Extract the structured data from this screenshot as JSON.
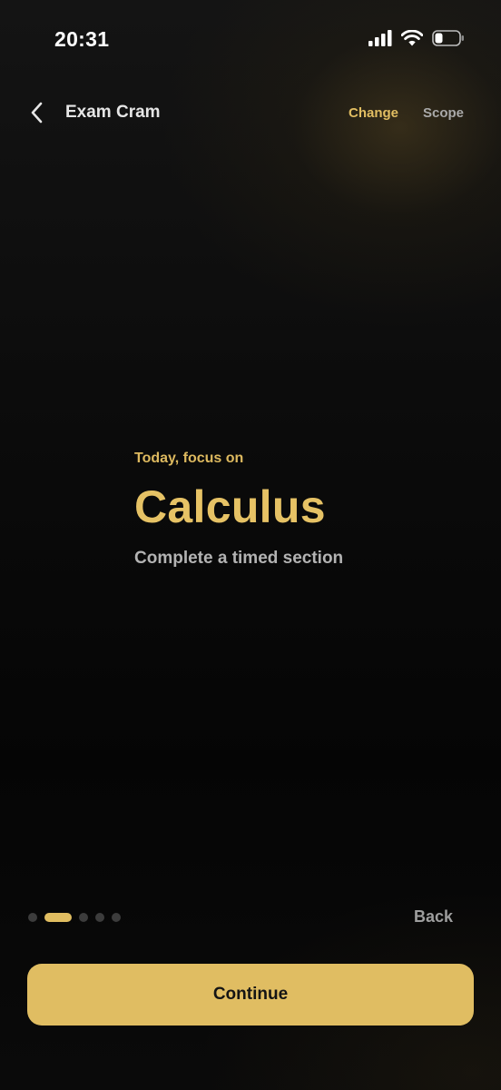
{
  "status_bar": {
    "time": "20:31",
    "icons": [
      "signal-icon",
      "wifi-icon",
      "battery-icon"
    ]
  },
  "nav": {
    "title": "Exam Cram",
    "change_label": "Change",
    "scope_label": "Scope"
  },
  "focus": {
    "eyebrow": "Today, focus on",
    "subject": "Calculus",
    "task": "Complete a timed section"
  },
  "pager": {
    "total": 5,
    "active_index": 1,
    "back_label": "Back"
  },
  "cta": {
    "continue_label": "Continue"
  },
  "colors": {
    "accent": "#e0bd62",
    "background": "#0b0b0b",
    "muted_text": "#a9a9a9"
  }
}
